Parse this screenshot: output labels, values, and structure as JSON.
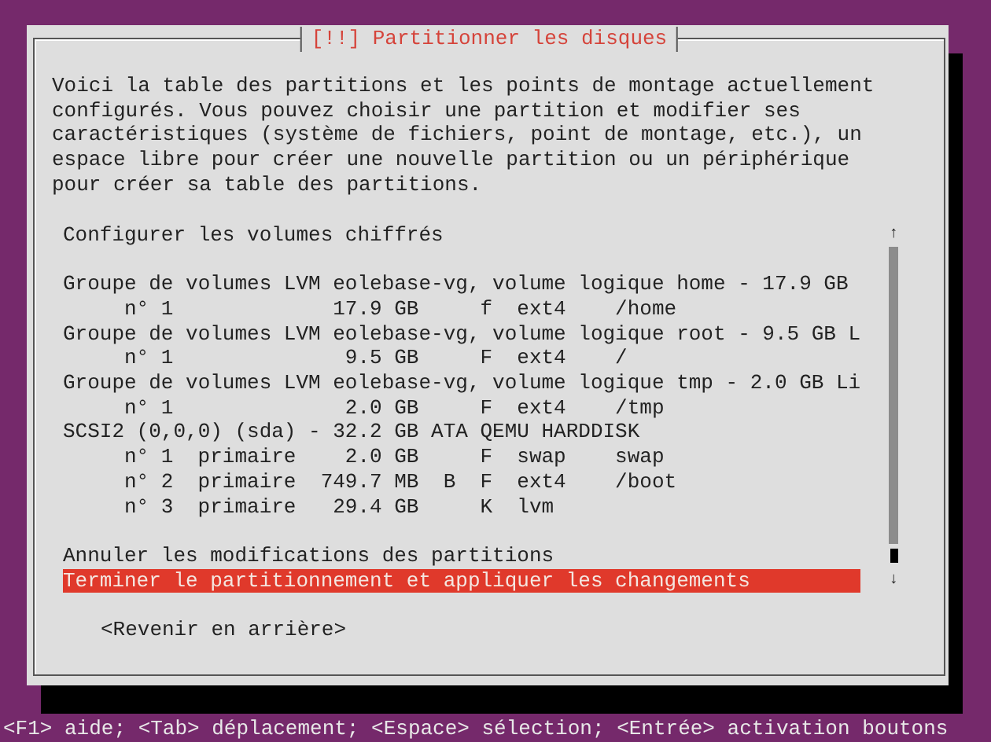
{
  "dialog": {
    "title": "[!!] Partitionner les disques",
    "description": "Voici la table des partitions et les points de montage actuellement configurés. Vous pouvez choisir une partition et modifier ses caractéristiques (système de fichiers, point de montage, etc.), un espace libre pour créer une nouvelle partition ou un périphérique pour créer sa table des partitions.",
    "list": {
      "items": [
        {
          "kind": "entry",
          "text": "Configurer les volumes chiffrés",
          "selected": false
        },
        {
          "kind": "spacer"
        },
        {
          "kind": "entry",
          "text": "Groupe de volumes LVM eolebase-vg, volume logique home - 17.9 GB",
          "selected": false
        },
        {
          "kind": "partition",
          "text": "n° 1             17.9 GB     f  ext4    /home",
          "selected": false
        },
        {
          "kind": "entry",
          "text": "Groupe de volumes LVM eolebase-vg, volume logique root - 9.5 GB L",
          "selected": false
        },
        {
          "kind": "partition",
          "text": "n° 1              9.5 GB     F  ext4    /",
          "selected": false
        },
        {
          "kind": "entry",
          "text": "Groupe de volumes LVM eolebase-vg, volume logique tmp - 2.0 GB Li",
          "selected": false
        },
        {
          "kind": "partition",
          "text": "n° 1              2.0 GB     F  ext4    /tmp",
          "selected": false
        },
        {
          "kind": "entry",
          "text": "SCSI2 (0,0,0) (sda) - 32.2 GB ATA QEMU HARDDISK",
          "selected": false
        },
        {
          "kind": "partition",
          "text": "n° 1  primaire    2.0 GB     F  swap    swap",
          "selected": false
        },
        {
          "kind": "partition",
          "text": "n° 2  primaire  749.7 MB  B  F  ext4    /boot",
          "selected": false
        },
        {
          "kind": "partition",
          "text": "n° 3  primaire   29.4 GB     K  lvm",
          "selected": false
        },
        {
          "kind": "spacer"
        },
        {
          "kind": "entry",
          "text": "Annuler les modifications des partitions",
          "selected": false
        },
        {
          "kind": "entry",
          "text": "Terminer le partitionnement et appliquer les changements",
          "selected": true
        }
      ]
    },
    "scroll_up": "↑",
    "scroll_down": "↓",
    "back_button": "<Revenir en arrière>"
  },
  "status_bar": "<F1> aide; <Tab> déplacement; <Espace> sélection; <Entrée> activation boutons"
}
